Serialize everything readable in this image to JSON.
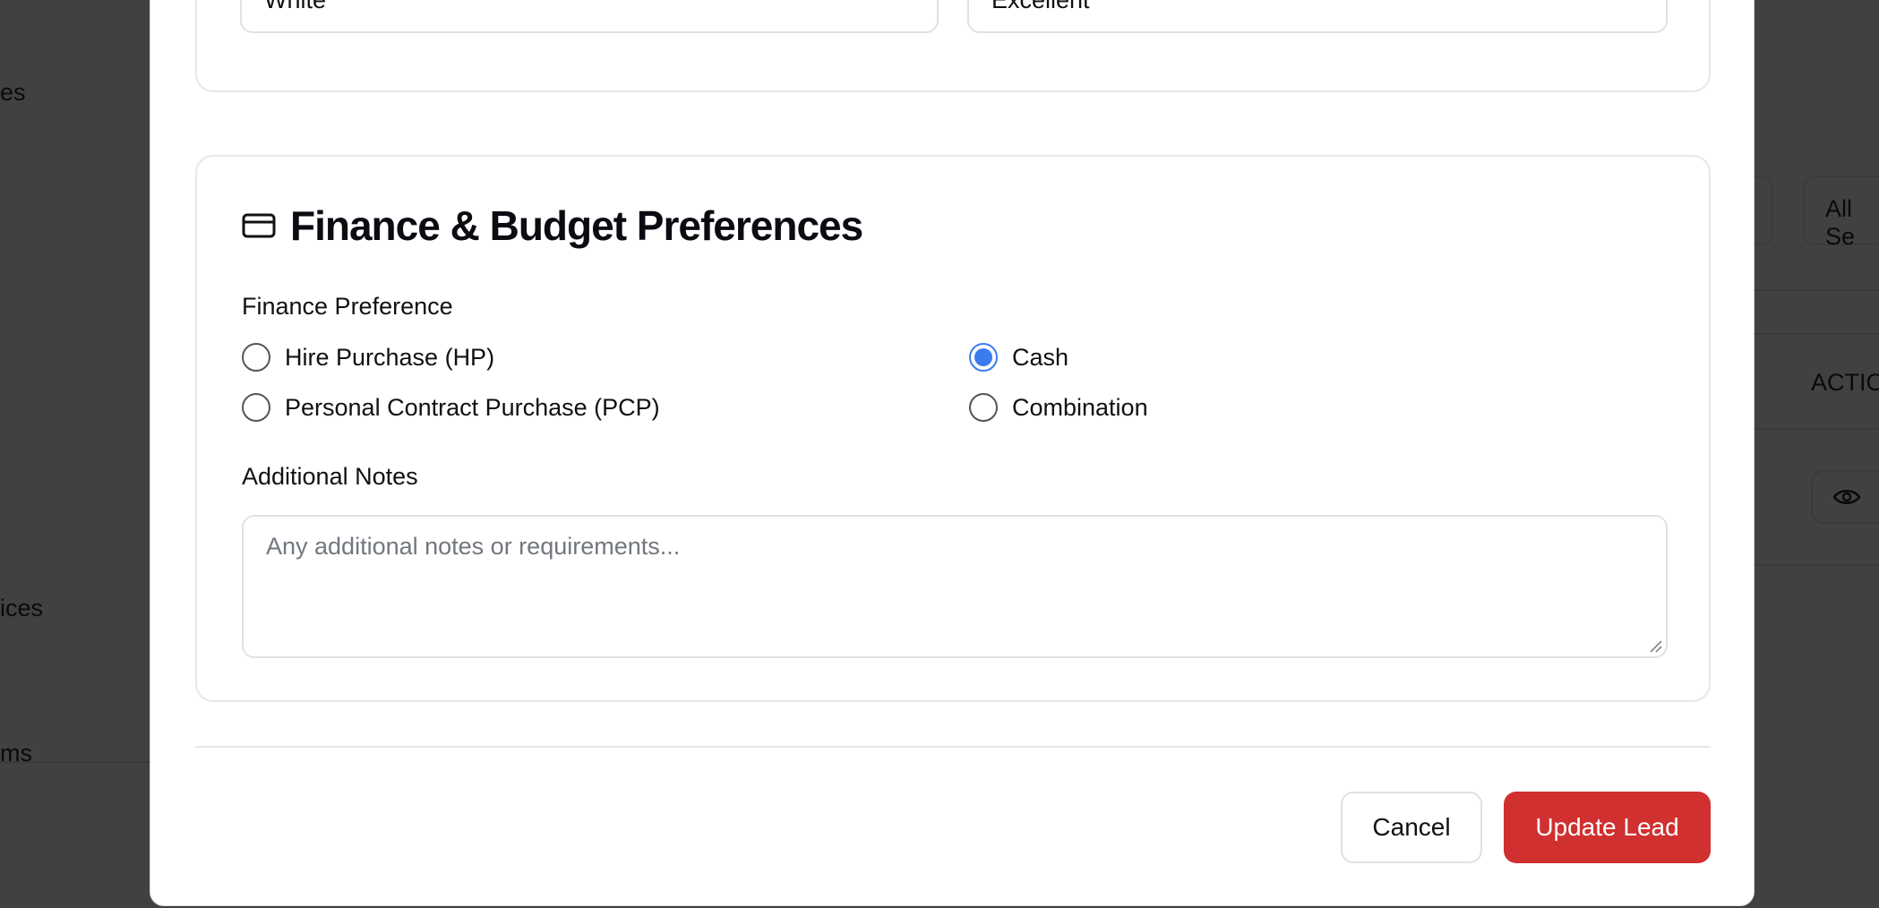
{
  "background": {
    "sidebar_fragments": [
      "es",
      "ices",
      "ms"
    ],
    "filter_fragment": "All Se",
    "actions_header": "ACTIC",
    "row_icon": "eye-icon"
  },
  "vehicle_fields": {
    "colour_value": "White",
    "condition_value": "Excellent"
  },
  "finance_section": {
    "icon": "credit-card-icon",
    "title": "Finance & Budget Preferences",
    "finance_preference_label": "Finance Preference",
    "options": [
      {
        "label": "Hire Purchase (HP)",
        "checked": false
      },
      {
        "label": "Cash",
        "checked": true
      },
      {
        "label": "Personal Contract Purchase (PCP)",
        "checked": false
      },
      {
        "label": "Combination",
        "checked": false
      }
    ],
    "notes_label": "Additional Notes",
    "notes_placeholder": "Any additional notes or requirements...",
    "notes_value": ""
  },
  "footer": {
    "cancel_label": "Cancel",
    "submit_label": "Update Lead"
  },
  "colors": {
    "accent": "#d0302f",
    "radio_checked": "#3b7bf0",
    "overlay": "#414141"
  }
}
